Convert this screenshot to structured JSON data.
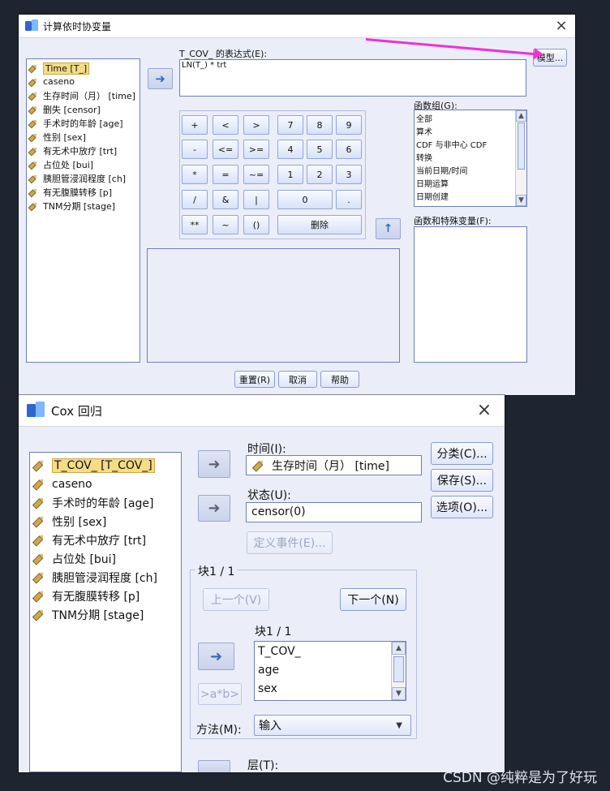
{
  "dialog_compute": {
    "title": "计算依时协变量",
    "variables": [
      "Time [T_]",
      "caseno",
      "生存时间（月） [time]",
      "删失 [censor]",
      "手术时的年龄 [age]",
      "性别 [sex]",
      "有无术中放疗 [trt]",
      "占位处 [bui]",
      "胰胆管浸润程度 [ch]",
      "有无腹膜转移 [p]",
      "TNM分期 [stage]"
    ],
    "expression_label": "T_COV_ 的表达式(E):",
    "expression_value": "LN(T_) * trt",
    "model_button": "模型...",
    "function_groups_label": "函数组(G):",
    "function_groups": [
      "全部",
      "算术",
      "CDF 与非中心 CDF",
      "转换",
      "当前日期/时间",
      "日期运算",
      "日期创建"
    ],
    "functions_label": "函数和特殊变量(F):",
    "keypad": {
      "row1": [
        "+",
        "<",
        ">",
        "7",
        "8",
        "9"
      ],
      "row2": [
        "-",
        "<=",
        ">=",
        "4",
        "5",
        "6"
      ],
      "row3": [
        "*",
        "=",
        "~=",
        "1",
        "2",
        "3"
      ],
      "row4": [
        "/",
        "&",
        "|",
        "0",
        "."
      ],
      "row5": [
        "**",
        "~",
        "()",
        "删除"
      ]
    },
    "buttons": {
      "reset": "重置(R)",
      "cancel": "取消",
      "help": "帮助"
    }
  },
  "dialog_cox": {
    "title": "Cox 回归",
    "variables": [
      "T_COV_ [T_COV_]",
      "caseno",
      "手术时的年龄 [age]",
      "性别 [sex]",
      "有无术中放疗 [trt]",
      "占位处 [bui]",
      "胰胆管浸润程度 [ch]",
      "有无腹膜转移 [p]",
      "TNM分期 [stage]"
    ],
    "time_label": "时间(I):",
    "time_value": "生存时间（月） [time]",
    "status_label": "状态(U):",
    "status_value": "censor(0)",
    "define_event": "定义事件(E)...",
    "block_outer": "块1 / 1",
    "prev_button": "上一个(V)",
    "next_button": "下一个(N)",
    "block_inner": "块1 / 1",
    "block_items": [
      "T_COV_",
      "age",
      "sex"
    ],
    "interaction_button": ">a*b>",
    "method_label": "方法(M):",
    "method_value": "输入",
    "layer_label": "层(T):",
    "right_buttons": {
      "classify": "分类(C)...",
      "save": "保存(S)...",
      "options": "选项(O)..."
    }
  },
  "page": {
    "watermark": "CSDN @纯粹是为了好玩",
    "accent_color": "#f030d8"
  }
}
